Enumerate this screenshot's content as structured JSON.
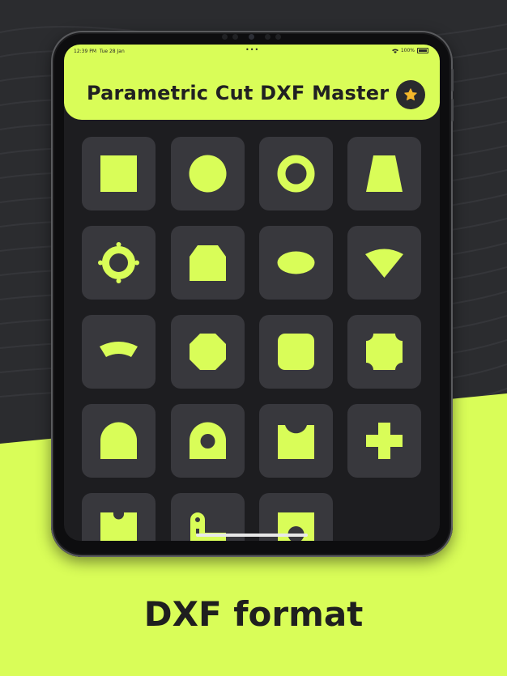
{
  "colors": {
    "accent": "#d9fd58",
    "dark": "#1d1d20",
    "tile": "#38383d",
    "star": "#f5b72b"
  },
  "status_bar": {
    "time": "12:39 PM",
    "date": "Tue 28 Jan",
    "dots": "•••",
    "battery": "100%"
  },
  "header": {
    "title": "Parametric Cut DXF Master",
    "favorite_icon": "star-icon"
  },
  "shapes": [
    "square",
    "circle",
    "ring",
    "trapezoid",
    "flange",
    "chamfered-pentagon",
    "ellipse",
    "sector",
    "arc-segment",
    "octagon",
    "rounded-square",
    "notched-square",
    "arch",
    "arch-with-hole",
    "concave-top-rect",
    "cross",
    "u-cutout-plate",
    "slotted-tab",
    "plate-with-hole"
  ],
  "caption": "DXF format"
}
